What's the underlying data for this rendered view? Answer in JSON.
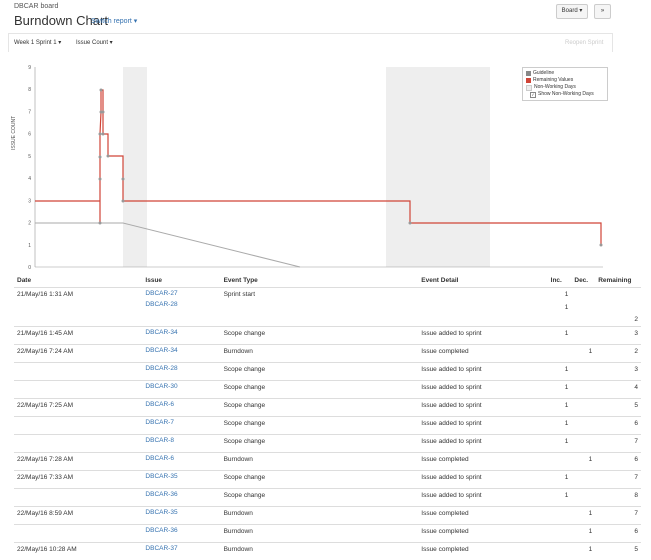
{
  "header": {
    "breadcrumb": "DBCAR board",
    "title": "Burndown Chart",
    "switch_report": "Switch report ▾",
    "board_button": "Board ▾",
    "more_button": "»"
  },
  "toolbar": {
    "sprint_select": "Week 1 Sprint 1 ▾",
    "estimation_select": "Issue Count ▾",
    "reopen_sprint": "Reopen Sprint"
  },
  "chart_data": {
    "type": "line",
    "ylabel": "ISSUE COUNT",
    "ylim": [
      0,
      9
    ],
    "yticks": [
      "0",
      "1",
      "2",
      "3",
      "4",
      "5",
      "6",
      "7",
      "8",
      "9"
    ],
    "legend": [
      {
        "name": "Guideline",
        "color": "#888888"
      },
      {
        "name": "Remaining Values",
        "color": "#d04437"
      },
      {
        "name": "Non-Working Days",
        "color": "#eeeeee"
      },
      {
        "name": "Show Non-Working Days",
        "checkbox": true
      }
    ],
    "series": [
      {
        "name": "Remaining Values",
        "color": "#d04437"
      },
      {
        "name": "Guideline",
        "color": "#aaaaaa"
      }
    ]
  },
  "table": {
    "headers": [
      "Date",
      "Issue",
      "Event Type",
      "Event Detail",
      "Inc.",
      "Dec.",
      "Remaining"
    ],
    "rows": [
      {
        "date": "21/May/16 1:31 AM",
        "issues": [
          "DBCAR-27",
          "DBCAR-28"
        ],
        "type": "Sprint start",
        "detail": "",
        "inc": "1\n1",
        "dec": "",
        "rem": "2"
      },
      {
        "date": "21/May/16 1:45 AM",
        "issues": [
          "DBCAR-34"
        ],
        "type": "Scope change",
        "detail": "Issue added to sprint",
        "inc": "1",
        "dec": "",
        "rem": "3"
      },
      {
        "date": "22/May/16 7:24 AM",
        "issues": [
          "DBCAR-34"
        ],
        "type": "Burndown",
        "detail": "Issue completed",
        "inc": "",
        "dec": "1",
        "rem": "2"
      },
      {
        "date": "",
        "issues": [
          "DBCAR-28"
        ],
        "type": "Scope change",
        "detail": "Issue added to sprint",
        "inc": "1",
        "dec": "",
        "rem": "3"
      },
      {
        "date": "",
        "issues": [
          "DBCAR-30"
        ],
        "type": "Scope change",
        "detail": "Issue added to sprint",
        "inc": "1",
        "dec": "",
        "rem": "4"
      },
      {
        "date": "22/May/16 7:25 AM",
        "issues": [
          "DBCAR-6"
        ],
        "type": "Scope change",
        "detail": "Issue added to sprint",
        "inc": "1",
        "dec": "",
        "rem": "5"
      },
      {
        "date": "",
        "issues": [
          "DBCAR-7"
        ],
        "type": "Scope change",
        "detail": "Issue added to sprint",
        "inc": "1",
        "dec": "",
        "rem": "6"
      },
      {
        "date": "",
        "issues": [
          "DBCAR-8"
        ],
        "type": "Scope change",
        "detail": "Issue added to sprint",
        "inc": "1",
        "dec": "",
        "rem": "7"
      },
      {
        "date": "22/May/16 7:28 AM",
        "issues": [
          "DBCAR-6"
        ],
        "type": "Burndown",
        "detail": "Issue completed",
        "inc": "",
        "dec": "1",
        "rem": "6"
      },
      {
        "date": "22/May/16 7:33 AM",
        "issues": [
          "DBCAR-35"
        ],
        "type": "Scope change",
        "detail": "Issue added to sprint",
        "inc": "1",
        "dec": "",
        "rem": "7"
      },
      {
        "date": "",
        "issues": [
          "DBCAR-36"
        ],
        "type": "Scope change",
        "detail": "Issue added to sprint",
        "inc": "1",
        "dec": "",
        "rem": "8"
      },
      {
        "date": "22/May/16 8:59 AM",
        "issues": [
          "DBCAR-35"
        ],
        "type": "Burndown",
        "detail": "Issue completed",
        "inc": "",
        "dec": "1",
        "rem": "7"
      },
      {
        "date": "",
        "issues": [
          "DBCAR-36"
        ],
        "type": "Burndown",
        "detail": "Issue completed",
        "inc": "",
        "dec": "1",
        "rem": "6"
      },
      {
        "date": "22/May/16 10:28 AM",
        "issues": [
          "DBCAR-37"
        ],
        "type": "Burndown",
        "detail": "Issue completed",
        "inc": "",
        "dec": "1",
        "rem": "5"
      }
    ]
  }
}
